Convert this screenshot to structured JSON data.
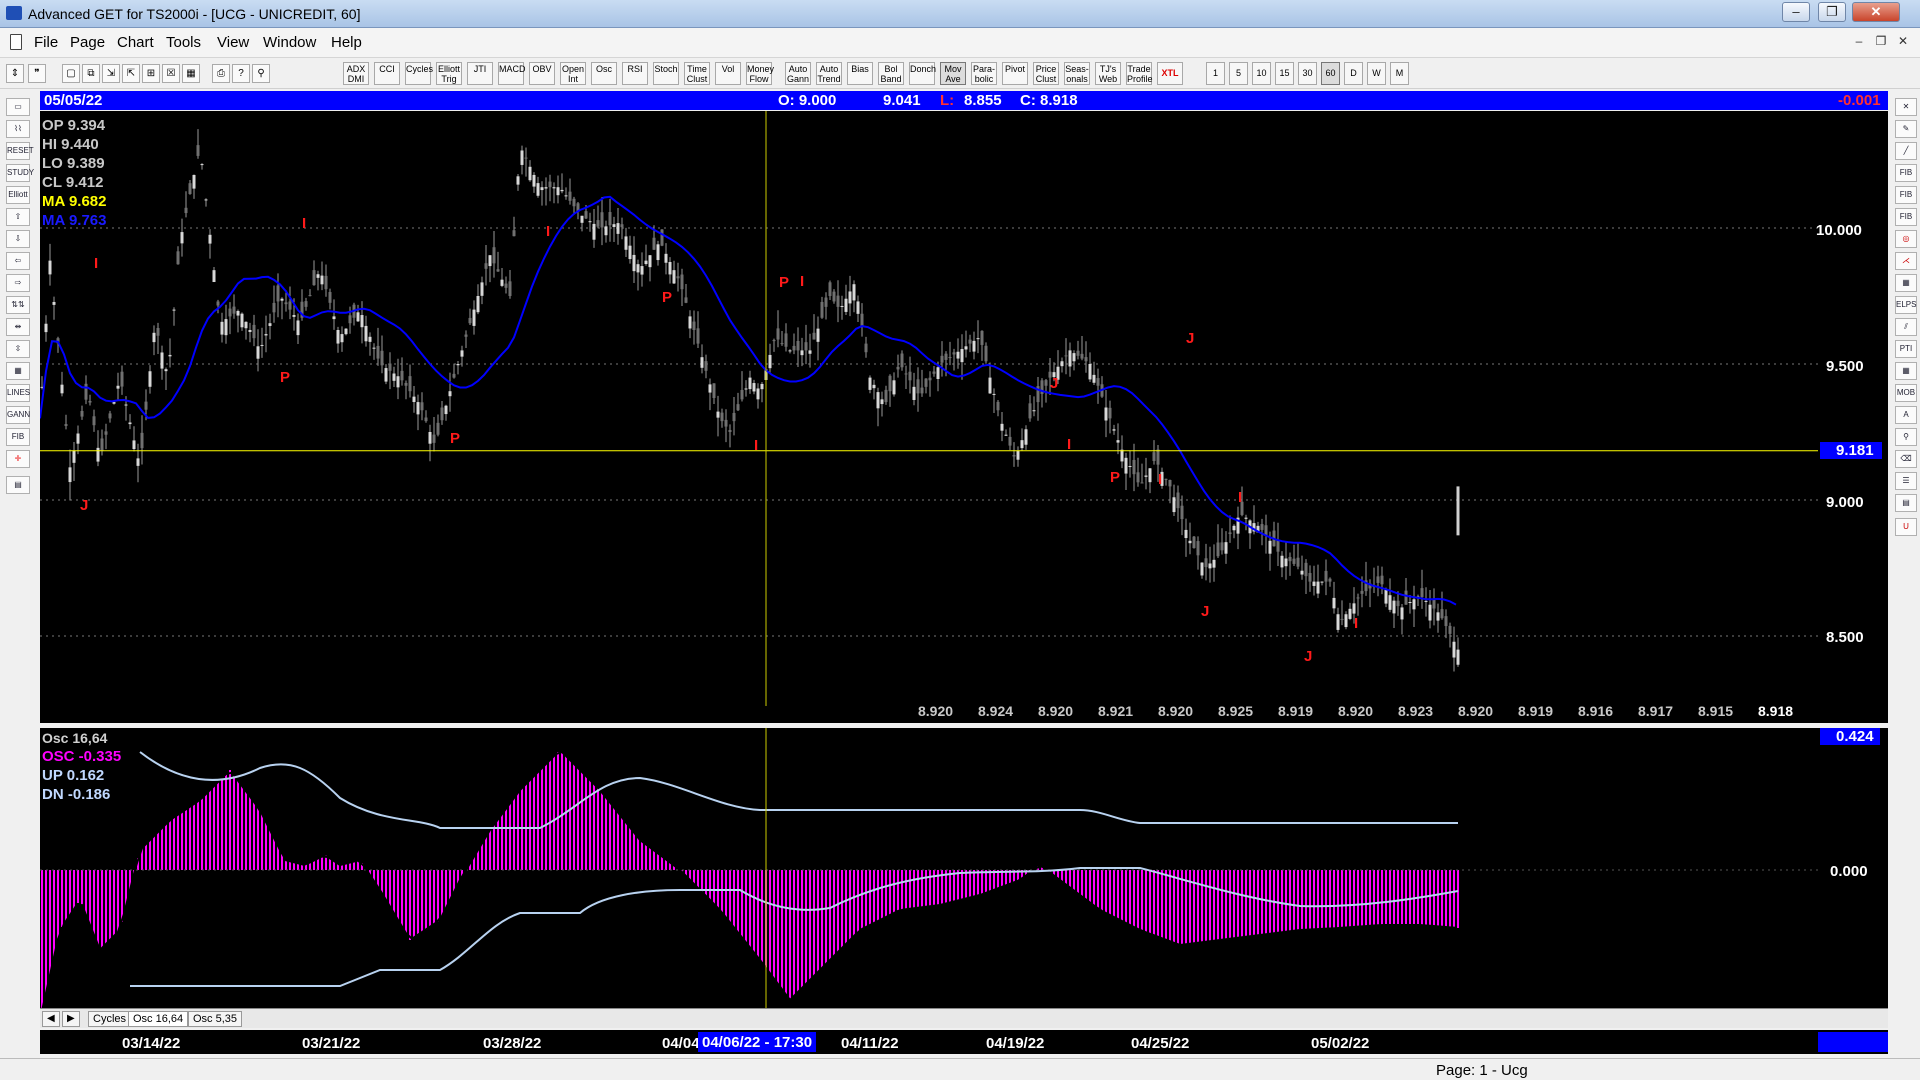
{
  "window": {
    "title": "Advanced GET for TS2000i - [UCG - UNICREDIT, 60]",
    "min": "–",
    "max": "❐",
    "close": "✕"
  },
  "menu": {
    "items": [
      "File",
      "Page",
      "Chart",
      "Tools",
      "View",
      "Window",
      "Help"
    ]
  },
  "toolbar": {
    "buttons": [
      "ADX DMI",
      "CCI",
      "Cycles",
      "Elliott Trig",
      "JTI",
      "MACD",
      "OBV",
      "Open Int",
      "Osc",
      "RSI",
      "Stoch",
      "Time Clust",
      "Vol",
      "Money Flow",
      "Auto Gann",
      "Auto Trend",
      "Bias",
      "Bol Band",
      "Donch",
      "Mov Ave",
      "Para-bolic",
      "Pivot",
      "Price Clust",
      "Seas-onals",
      "TJ's Web",
      "Trade Profile",
      "XTL"
    ],
    "intervals": [
      "1",
      "5",
      "10",
      "15",
      "30",
      "60",
      "D",
      "W",
      "M"
    ],
    "selected_interval": "60"
  },
  "header": {
    "date": "05/05/22",
    "open": "O: 9.000",
    "high": "9.041",
    "low_label": "L:",
    "low": "8.855",
    "close": "C: 8.918",
    "change": "-0.001"
  },
  "price_info": {
    "op": "OP  9.394",
    "hi": "HI   9.440",
    "lo": "LO  9.389",
    "cl": "CL  9.412",
    "ma1": "MA  9.682",
    "ma2": "MA  9.763",
    "ma1_color": "#ffff00",
    "ma2_color": "#0000ff"
  },
  "price_axis": {
    "levels": [
      "10.000",
      "9.500",
      "9.000",
      "8.500"
    ],
    "current_line": "9.181"
  },
  "pivot_values": [
    "8.920",
    "8.924",
    "8.920",
    "8.921",
    "8.920",
    "8.925",
    "8.919",
    "8.920",
    "8.923",
    "8.920",
    "8.919",
    "8.916",
    "8.917",
    "8.915",
    "8.918"
  ],
  "markers": {
    "labels": [
      "J",
      "I",
      "P",
      "I",
      "P",
      "I",
      "P",
      "I",
      "P",
      "I",
      "J",
      "I",
      "J",
      "P",
      "I",
      "I",
      "J",
      "J",
      "I"
    ]
  },
  "osc_info": {
    "title": "Osc 16,64",
    "osc": "OSC -0.335",
    "up": "UP   0.162",
    "dn": "DN   -0.186",
    "axis_top": "0.424",
    "axis_zero": "0.000"
  },
  "tabs": [
    "Cycles",
    "Osc 16,64",
    "Osc 5,35"
  ],
  "dates": [
    "03/14/22",
    "03/21/22",
    "03/28/22",
    "04/04",
    "04/06/22 - 17:30",
    "04/11/22",
    "04/19/22",
    "04/25/22",
    "05/02/22"
  ],
  "status": {
    "page": "Page: 1 - Ucg"
  }
}
